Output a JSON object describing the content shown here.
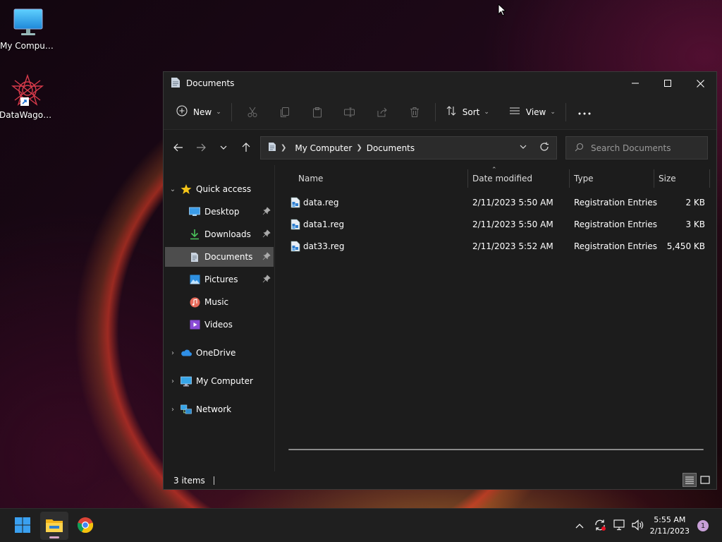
{
  "desktop": {
    "icons": [
      {
        "label": "My Computer",
        "icon": "monitor-icon"
      },
      {
        "label": "DataWagon...",
        "icon": "datawagon-app-icon"
      }
    ]
  },
  "window": {
    "title": "Documents",
    "commandbar": {
      "new_label": "New",
      "sort_label": "Sort",
      "view_label": "View",
      "disabled_icons": [
        "cut-icon",
        "copy-icon",
        "paste-icon",
        "rename-icon",
        "share-icon",
        "delete-icon"
      ]
    },
    "address": {
      "crumbs": [
        "My Computer",
        "Documents"
      ]
    },
    "search": {
      "placeholder": "Search Documents"
    },
    "navpane": {
      "items": [
        {
          "label": "Quick access",
          "icon": "star-icon",
          "expanded": true
        },
        {
          "label": "Desktop",
          "icon": "desktop-icon",
          "pinned": true
        },
        {
          "label": "Downloads",
          "icon": "download-icon",
          "pinned": true
        },
        {
          "label": "Documents",
          "icon": "documents-icon",
          "pinned": true,
          "selected": true
        },
        {
          "label": "Pictures",
          "icon": "pictures-icon",
          "pinned": true
        },
        {
          "label": "Music",
          "icon": "music-icon"
        },
        {
          "label": "Videos",
          "icon": "videos-icon"
        },
        {
          "label": "OneDrive",
          "icon": "cloud-icon",
          "expanded": false
        },
        {
          "label": "My Computer",
          "icon": "monitor-icon",
          "expanded": false
        },
        {
          "label": "Network",
          "icon": "network-icon",
          "expanded": false
        }
      ]
    },
    "columns": {
      "name": "Name",
      "date": "Date modified",
      "type": "Type",
      "size": "Size"
    },
    "files": [
      {
        "name": "data.reg",
        "date": "2/11/2023 5:50 AM",
        "type": "Registration Entries",
        "size": "2 KB"
      },
      {
        "name": "data1.reg",
        "date": "2/11/2023 5:50 AM",
        "type": "Registration Entries",
        "size": "3 KB"
      },
      {
        "name": "dat33.reg",
        "date": "2/11/2023 5:52 AM",
        "type": "Registration Entries",
        "size": "5,450 KB"
      }
    ],
    "status": {
      "count": "3 items"
    }
  },
  "taskbar": {
    "apps": [
      "start-icon",
      "file-explorer-icon",
      "chrome-icon"
    ],
    "time": "5:55 AM",
    "date": "2/11/2023",
    "notifications": "1"
  },
  "colors": {
    "window_bg": "#1c1c1c",
    "titlebar_bg": "#202020",
    "selected_bg": "#4d4d4d",
    "taskbar_bg": "#1f1f1f",
    "accent_blue": "#3a9ce8",
    "star_gold": "#f5c518"
  }
}
